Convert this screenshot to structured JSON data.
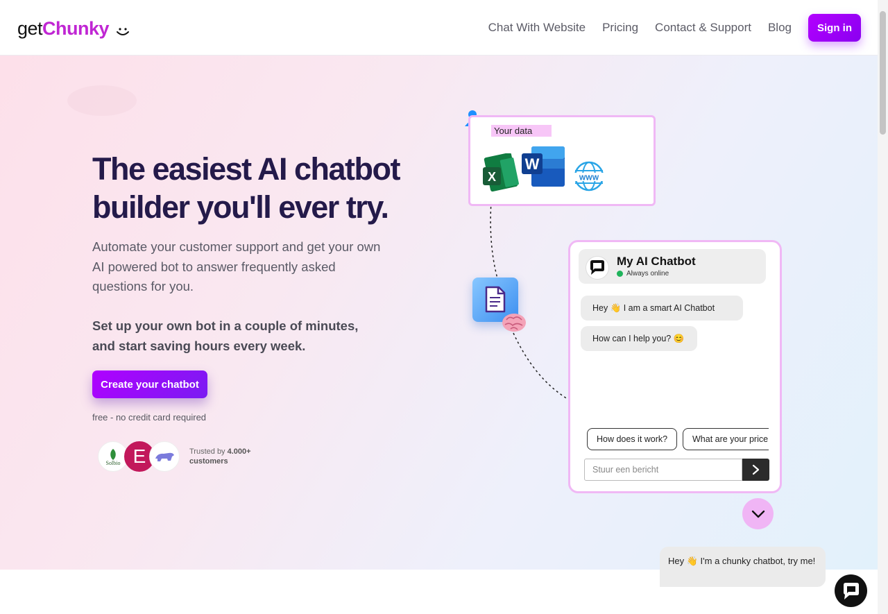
{
  "header": {
    "logo_get": "get",
    "logo_chunky": "Chunky",
    "nav": [
      "Chat With Website",
      "Pricing",
      "Contact & Support",
      "Blog"
    ],
    "signin_label": "Sign in"
  },
  "hero": {
    "title": "The easiest AI chatbot builder you'll ever try.",
    "subtitle": "Automate your customer support and get your own AI powered bot to answer frequently asked questions for you.",
    "subtitle2": "Set up your own bot in a couple of minutes, and start saving hours every week.",
    "cta_label": "Create your chatbot",
    "free_note": "free - no credit card required",
    "trusted_prefix": "Trusted by",
    "trusted_count": "4.000+",
    "trusted_suffix": "customers",
    "customer_logos": [
      "Solbio",
      "E",
      "bear"
    ]
  },
  "illustration": {
    "data_label": "Your data",
    "chat": {
      "bot_name": "My AI Chatbot",
      "status": "Always online",
      "messages": [
        "Hey 👋 I am a smart AI Chatbot",
        "How can I help you? 😊"
      ],
      "quick_replies": [
        "How does it work?",
        "What are your price"
      ],
      "input_placeholder": "Stuur een bericht"
    }
  },
  "floating": {
    "promo_text": "Hey 👋 I'm a chunky chatbot, try me!"
  },
  "colors": {
    "brand": "#c026d3",
    "button_purple": "#9b00ff",
    "accent_pink": "#f0b8f5",
    "title": "#241a4a"
  }
}
